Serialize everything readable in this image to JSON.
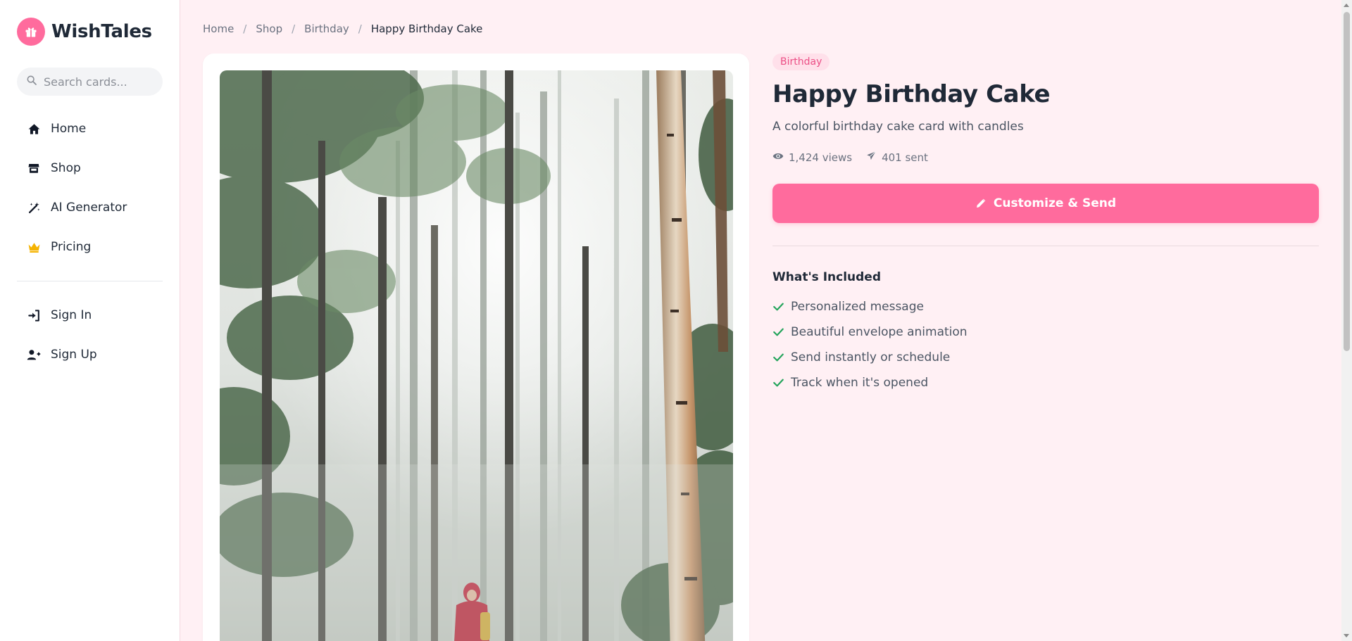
{
  "brand": {
    "name": "WishTales",
    "logo_icon": "gift-icon",
    "accent": "#ff6b9d"
  },
  "search": {
    "placeholder": "Search cards..."
  },
  "sidebar": {
    "items": [
      {
        "label": "Home",
        "icon": "home-icon"
      },
      {
        "label": "Shop",
        "icon": "store-icon"
      },
      {
        "label": "AI Generator",
        "icon": "magic-wand-icon"
      },
      {
        "label": "Pricing",
        "icon": "crown-icon"
      }
    ],
    "auth": [
      {
        "label": "Sign In",
        "icon": "sign-in-icon"
      },
      {
        "label": "Sign Up",
        "icon": "user-plus-icon"
      }
    ]
  },
  "breadcrumb": {
    "items": [
      "Home",
      "Shop",
      "Birthday"
    ],
    "separator": "/",
    "current": "Happy Birthday Cake"
  },
  "card": {
    "category": "Birthday",
    "title": "Happy Birthday Cake",
    "description": "A colorful birthday cake card with candles",
    "views": "1,424 views",
    "sent": "401 sent",
    "cta_label": "Customize & Send",
    "image_alt": "Misty forest with a hiker in a red jacket"
  },
  "included": {
    "title": "What's Included",
    "items": [
      "Personalized message",
      "Beautiful envelope animation",
      "Send instantly or schedule",
      "Track when it's opened"
    ]
  },
  "colors": {
    "accent": "#ff6b9d",
    "background": "#fff0f4",
    "check": "#22a35a",
    "badge_bg": "#ffe0ea",
    "crown": "#f5b301"
  }
}
